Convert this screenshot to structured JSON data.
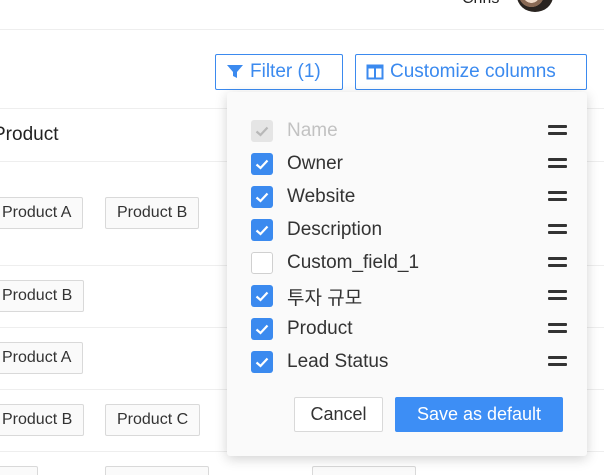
{
  "header": {
    "user_name": "Chris"
  },
  "toolbar": {
    "filter_label": "Filter (1)",
    "customize_label": "Customize columns",
    "accent_color": "#3b8aef"
  },
  "table": {
    "column_header": "Product",
    "rows": [
      {
        "tags": [
          "Product A",
          "Product B"
        ]
      },
      {
        "tags": [
          "Product B"
        ]
      },
      {
        "tags": [
          "Product A"
        ]
      },
      {
        "tags": [
          "Product B",
          "Product C"
        ]
      }
    ]
  },
  "customize_popover": {
    "columns": [
      {
        "label": "Name",
        "checked": true,
        "disabled": true
      },
      {
        "label": "Owner",
        "checked": true,
        "disabled": false
      },
      {
        "label": "Website",
        "checked": true,
        "disabled": false
      },
      {
        "label": "Description",
        "checked": true,
        "disabled": false
      },
      {
        "label": "Custom_field_1",
        "checked": false,
        "disabled": false
      },
      {
        "label": "투자 규모",
        "checked": true,
        "disabled": false
      },
      {
        "label": "Product",
        "checked": true,
        "disabled": false
      },
      {
        "label": "Lead Status",
        "checked": true,
        "disabled": false
      }
    ],
    "cancel_label": "Cancel",
    "save_label": "Save as default"
  }
}
